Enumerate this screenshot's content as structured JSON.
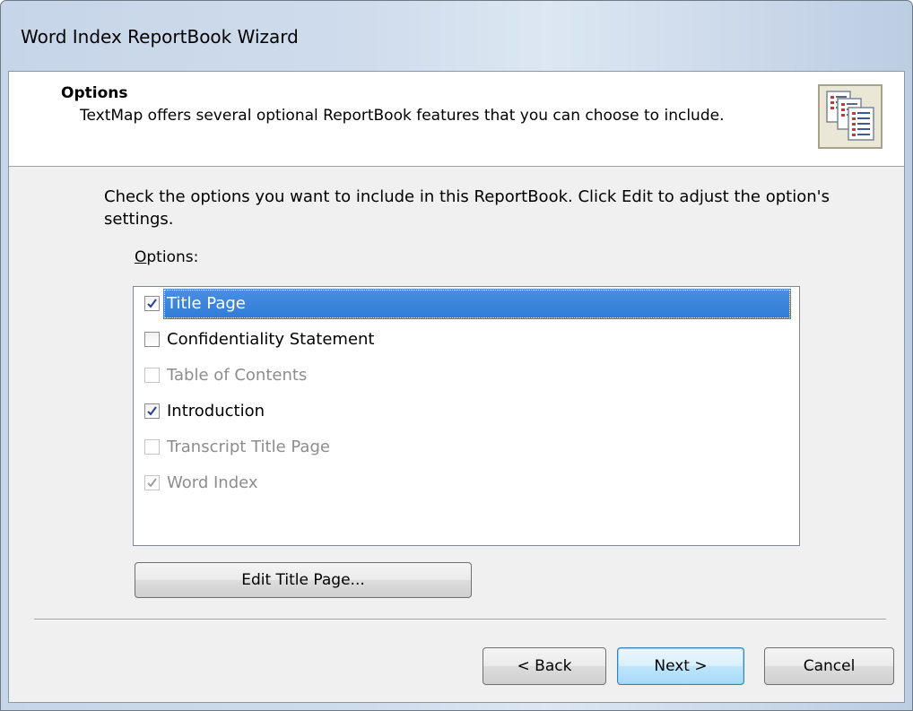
{
  "window": {
    "title": "Word Index ReportBook Wizard"
  },
  "header": {
    "title": "Options",
    "description": "TextMap offers several optional ReportBook features that you can choose to include.",
    "icon": "reportbook-pages-icon"
  },
  "instruction": "Check the options you want to include in this ReportBook.  Click Edit to adjust the option's settings.",
  "options_label": {
    "mnemonic": "O",
    "rest": "ptions:"
  },
  "options": [
    {
      "label": "Title Page",
      "checked": true,
      "enabled": true,
      "selected": true
    },
    {
      "label": "Confidentiality Statement",
      "checked": false,
      "enabled": true,
      "selected": false
    },
    {
      "label": "Table of Contents",
      "checked": false,
      "enabled": false,
      "selected": false
    },
    {
      "label": "Introduction",
      "checked": true,
      "enabled": true,
      "selected": false
    },
    {
      "label": "Transcript Title Page",
      "checked": false,
      "enabled": false,
      "selected": false
    },
    {
      "label": "Word Index",
      "checked": true,
      "enabled": false,
      "selected": false
    }
  ],
  "edit_button": "Edit Title Page...",
  "nav": {
    "back": "< Back",
    "next": "Next >",
    "cancel": "Cancel"
  },
  "colors": {
    "selection": "#3483de",
    "default_button_border": "#3c7fb1",
    "disabled_text": "#8d8d8d"
  }
}
